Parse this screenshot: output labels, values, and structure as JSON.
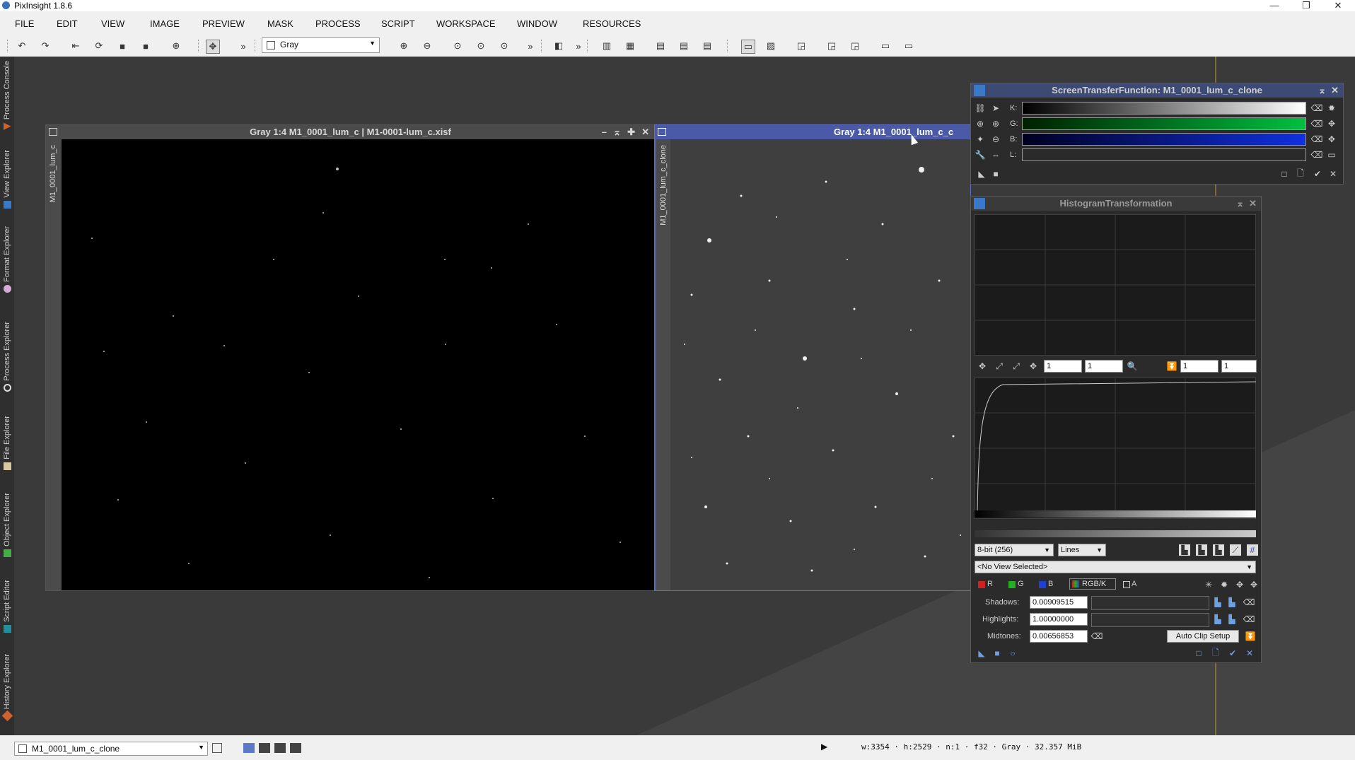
{
  "window": {
    "title": "PixInsight 1.8.6"
  },
  "menu": [
    "FILE",
    "EDIT",
    "VIEW",
    "IMAGE",
    "PREVIEW",
    "MASK",
    "PROCESS",
    "SCRIPT",
    "WORKSPACE",
    "WINDOW",
    "RESOURCES"
  ],
  "toolbar": {
    "mode_select": "Gray"
  },
  "dock_tabs": [
    "Process Console",
    "View Explorer",
    "Format Explorer",
    "Process Explorer",
    "File Explorer",
    "Object Explorer",
    "Script Editor",
    "History Explorer"
  ],
  "image_windows": [
    {
      "title": "Gray 1:4 M1_0001_lum_c | M1-0001-lum_c.xisf",
      "side_id": "M1_0001_lum_c"
    },
    {
      "title": "Gray 1:4 M1_0001_lum_c_c",
      "side_id": "M1_0001_lum_c_clone"
    }
  ],
  "stf": {
    "title": "ScreenTransferFunction: M1_0001_lum_c_clone",
    "channels": [
      "K:",
      "G:",
      "B:",
      "L:"
    ]
  },
  "ht": {
    "title": "HistogramTransformation",
    "zoom_h": "1",
    "zoom_v": "1",
    "zoom_h2": "1",
    "zoom_v2": "1",
    "resolution": "8-bit (256)",
    "plot_mode": "Lines",
    "view_select": "<No View Selected>",
    "channels": [
      "R",
      "G",
      "B",
      "RGB/K",
      "A"
    ],
    "shadows_label": "Shadows:",
    "shadows": "0.00909515",
    "highlights_label": "Highlights:",
    "highlights": "1.00000000",
    "midtones_label": "Midtones:",
    "midtones": "0.00656853",
    "auto_clip": "Auto Clip Setup"
  },
  "status": {
    "view": "M1_0001_lum_c_clone",
    "info": "w:3354 · h:2529 · n:1 · f32 · Gray · 32.357 MiB"
  }
}
